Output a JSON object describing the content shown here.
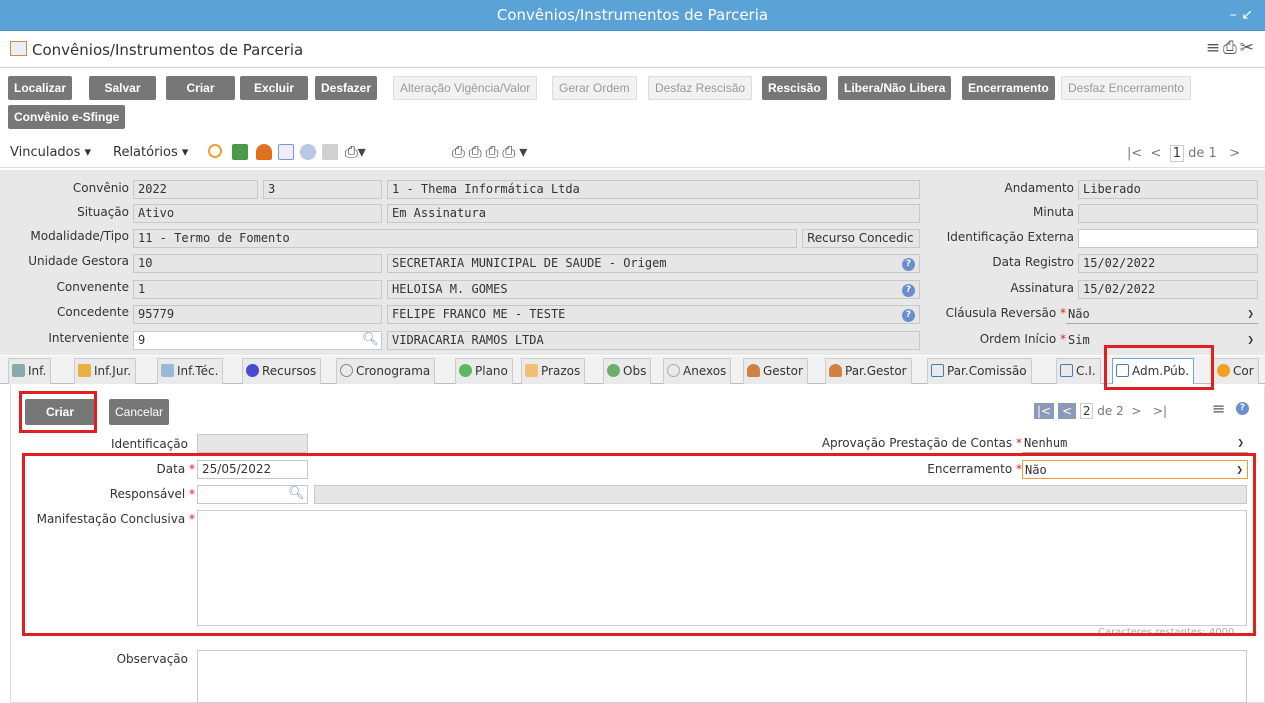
{
  "window": {
    "title": "Convênios/Instrumentos de Parceria",
    "controls": "– ↙"
  },
  "app": {
    "title": "Convênios/Instrumentos de Parceria",
    "icons": [
      "menu-icon",
      "print-icon",
      "tools-icon"
    ]
  },
  "toolbar": {
    "localizar": "Localizar",
    "salvar": "Salvar",
    "criar": "Criar",
    "excluir": "Excluir",
    "desfazer": "Desfazer",
    "alteracao": "Alteração Vigência/Valor",
    "gerar_ordem": "Gerar Ordem",
    "desfaz_rescisao": "Desfaz Rescisão",
    "rescisao": "Rescisão",
    "libera": "Libera/Não Libera",
    "encerramento": "Encerramento",
    "desfaz_encerramento": "Desfaz Encerramento",
    "convenio_esfinge": "Convênio e-Sfinge"
  },
  "menubar": {
    "vinculados": "Vinculados ▾",
    "relatorios": "Relatórios ▾",
    "page_label": "de 1",
    "page_value": "1"
  },
  "form": {
    "convenio_label": "Convênio",
    "convenio_ano": "2022",
    "convenio_num": "3",
    "convenio_nome": "1 - Thema Informática Ltda",
    "situacao_label": "Situação",
    "situacao": "Ativo",
    "situacao_desc": "Em Assinatura",
    "modalidade_label": "Modalidade/Tipo",
    "modalidade": "11 - Termo de Fomento",
    "recurso_concedido": "Recurso Concedic",
    "unidade_label": "Unidade Gestora",
    "unidade_cod": "10",
    "unidade_nome": "SECRETARIA MUNICIPAL DE SAUDE - Origem",
    "convenente_label": "Convenente",
    "convenente_cod": "1",
    "convenente_nome": "HELOISA M. GOMES",
    "concedente_label": "Concedente",
    "concedente_cod": "95779",
    "concedente_nome": "FELIPE FRANCO ME - TESTE",
    "interveniente_label": "Interveniente",
    "interveniente_cod": "9",
    "interveniente_nome": "VIDRACARIA RAMOS LTDA",
    "andamento_label": "Andamento",
    "andamento": "Liberado",
    "minuta_label": "Minuta",
    "minuta": "",
    "id_externa_label": "Identificação Externa",
    "id_externa": "",
    "data_registro_label": "Data Registro",
    "data_registro": "15/02/2022",
    "assinatura_label": "Assinatura",
    "assinatura": "15/02/2022",
    "clausula_label": "Cláusula Reversão",
    "clausula": "Não",
    "ordem_label": "Ordem Início",
    "ordem": "Sim"
  },
  "tabs": [
    "Inf.",
    "Inf.Jur.",
    "Inf.Téc.",
    "Recursos",
    "Cronograma",
    "Plano",
    "Prazos",
    "Obs",
    "Anexos",
    "Gestor",
    "Par.Gestor",
    "Par.Comissão",
    "C.I.",
    "Adm.Púb.",
    "Cor"
  ],
  "panel": {
    "criar": "Criar",
    "cancelar": "Cancelar",
    "page_value": "2",
    "page_label": "de 2",
    "identificacao_label": "Identificação",
    "identificacao": "",
    "aprovacao_label": "Aprovação Prestação de Contas",
    "aprovacao": "Nenhum",
    "data_label": "Data",
    "data": "25/05/2022",
    "encerramento_label": "Encerramento",
    "encerramento": "Não",
    "responsavel_label": "Responsável",
    "responsavel": "",
    "responsavel_nome": "",
    "manifestacao_label": "Manifestação Conclusiva",
    "manifestacao": "",
    "caracteres": "Caracteres restantes: 4000",
    "observacao_label": "Observação",
    "observacao": ""
  },
  "colors": {
    "title_bar": "#5ba3d6",
    "dark_button": "#777777",
    "highlight": "#e02020",
    "field_bg": "#e6e6e6"
  }
}
